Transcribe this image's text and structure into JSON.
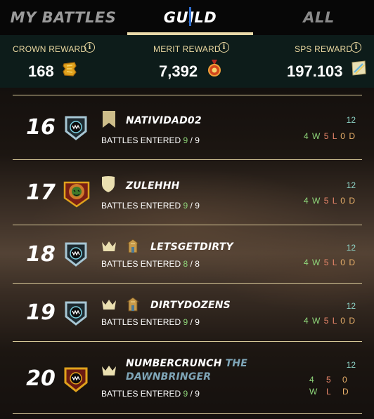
{
  "tabs": {
    "my_battles": "MY BATTLES",
    "guild": "GUILD",
    "all": "ALL",
    "active": "guild"
  },
  "rewards": {
    "crown": {
      "label": "CROWN REWARD",
      "value": "168",
      "icon": "crown-token-icon"
    },
    "merit": {
      "label": "MERIT REWARD",
      "value": "7,392",
      "icon": "merit-medal-icon"
    },
    "sps": {
      "label": "SPS REWARD",
      "value": "197.103",
      "icon": "sps-token-icon"
    }
  },
  "rows": [
    {
      "rank": "16",
      "name": "NATIVIDAD02",
      "name_title": "",
      "battles_label": "BATTLES ENTERED",
      "entered": "9",
      "sep": "/",
      "total": "9",
      "points": "12",
      "w": "4",
      "w_label": "W",
      "l": "5",
      "l_label": "L",
      "d": "0",
      "d_label": "D",
      "badges": [
        "banner-icon"
      ]
    },
    {
      "rank": "17",
      "name": "ZULEHHH",
      "name_title": "",
      "battles_label": "BATTLES ENTERED",
      "entered": "9",
      "sep": "/",
      "total": "9",
      "points": "12",
      "w": "4",
      "w_label": "W",
      "l": "5",
      "l_label": "L",
      "d": "0",
      "d_label": "D",
      "badges": [
        "shield-icon"
      ]
    },
    {
      "rank": "18",
      "name": "LETSGETDIRTY",
      "name_title": "",
      "battles_label": "BATTLES ENTERED",
      "entered": "8",
      "sep": "/",
      "total": "8",
      "points": "12",
      "w": "4",
      "w_label": "W",
      "l": "5",
      "l_label": "L",
      "d": "0",
      "d_label": "D",
      "badges": [
        "crown-icon",
        "guild-hall-icon"
      ]
    },
    {
      "rank": "19",
      "name": "DIRTYDOZENS",
      "name_title": "",
      "battles_label": "BATTLES ENTERED",
      "entered": "9",
      "sep": "/",
      "total": "9",
      "points": "12",
      "w": "4",
      "w_label": "W",
      "l": "5",
      "l_label": "L",
      "d": "0",
      "d_label": "D",
      "badges": [
        "crown-icon",
        "guild-hall-icon"
      ]
    },
    {
      "rank": "20",
      "name": "NUMBERCRUNCH",
      "name_title": "THE DAWNBRINGER",
      "name_line2": "DAWNBRINGER",
      "name_title_first": "THE",
      "battles_label": "BATTLES ENTERED",
      "entered": "9",
      "sep": "/",
      "total": "9",
      "points": "12",
      "w": "4",
      "w_label": "W",
      "l": "5",
      "l_label": "L",
      "d": "0",
      "d_label": "D",
      "badges": [
        "crown-icon"
      ]
    }
  ],
  "colors": {
    "accent": "#e9d9a8",
    "win": "#8fd67a",
    "loss": "#e8866a",
    "draw": "#e8b06a",
    "points": "#8fd6c9",
    "title": "#7fa6b8"
  }
}
